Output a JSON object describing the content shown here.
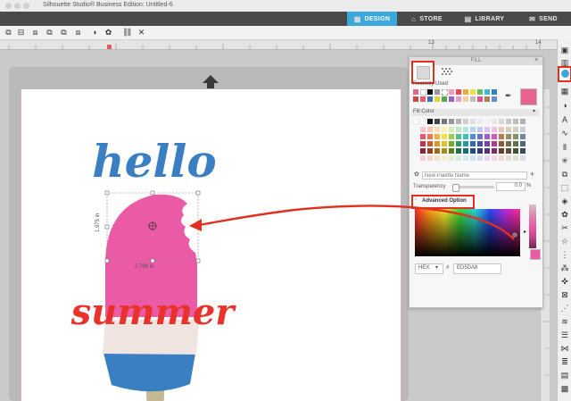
{
  "window": {
    "title": "Silhouette Studio® Business Edition: Untitled-6"
  },
  "tabs": [
    {
      "label": "DESIGN",
      "icon": "grid-icon"
    },
    {
      "label": "STORE",
      "icon": "store-icon"
    },
    {
      "label": "LIBRARY",
      "icon": "library-icon"
    },
    {
      "label": "SEND",
      "icon": "send-icon"
    }
  ],
  "ruler": {
    "numbers": [
      "13",
      "14"
    ]
  },
  "fill_panel": {
    "title": "FILL",
    "recently_used_label": "Recently Used",
    "fill_color_label": "Fill Color",
    "palette_name_placeholder": "New Palette Name",
    "transparency_label": "Transparency",
    "transparency_value": "0.0",
    "transparency_unit": "%",
    "advanced_label": "Advanced Option",
    "color_mode": "HEX",
    "hex_prefix": "#",
    "hex_value": "ED5DA8",
    "current_color": "#e8638a"
  },
  "artwork": {
    "hello_text": "hello",
    "summer_text": "summer",
    "width_label": "2.799 in",
    "height_label": "1.975 in",
    "colors": {
      "hello": "#3a7fc2",
      "summer": "#e8322b",
      "pink": "#ea5aa5",
      "cream": "#f0e4e0",
      "blue": "#3a7fc2",
      "stick": "#c4b896"
    }
  },
  "annotation": {
    "color": "#e0301e"
  }
}
